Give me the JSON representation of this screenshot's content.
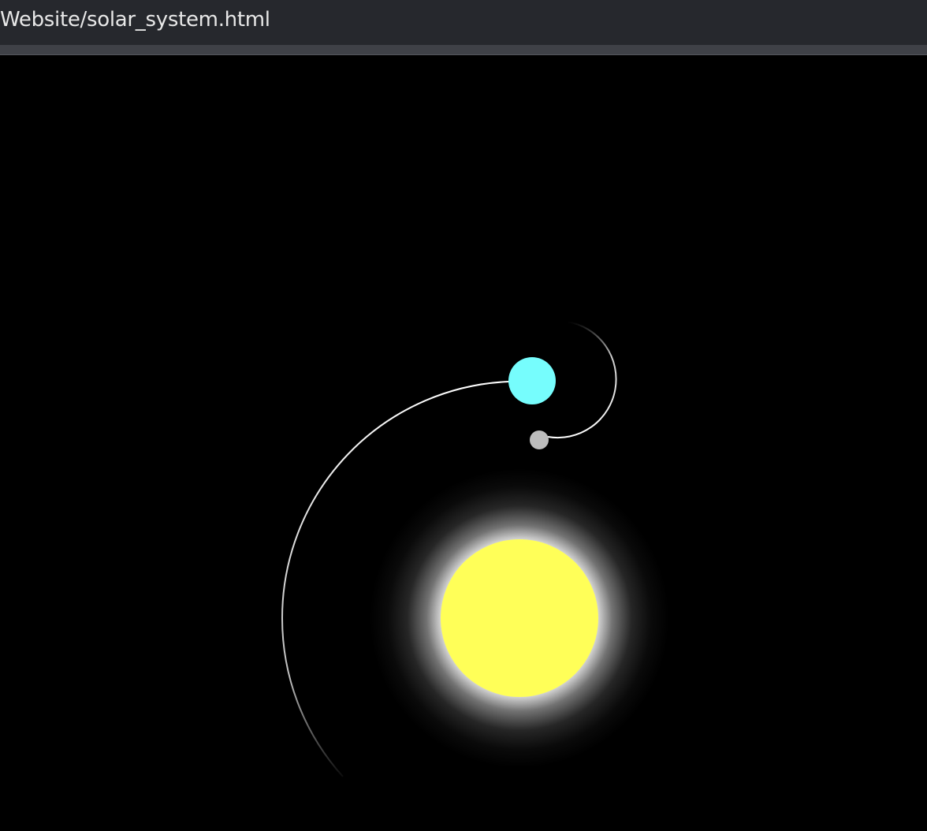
{
  "window": {
    "title": "Website/solar_system.html"
  },
  "scene": {
    "background_color": "#000000",
    "sun": {
      "color": "#ffff58",
      "glow_color": "#ffffff"
    },
    "planet": {
      "color": "#76fdfd"
    },
    "moon": {
      "color": "#bdbdbd"
    },
    "trail_color": "#ffffff"
  }
}
